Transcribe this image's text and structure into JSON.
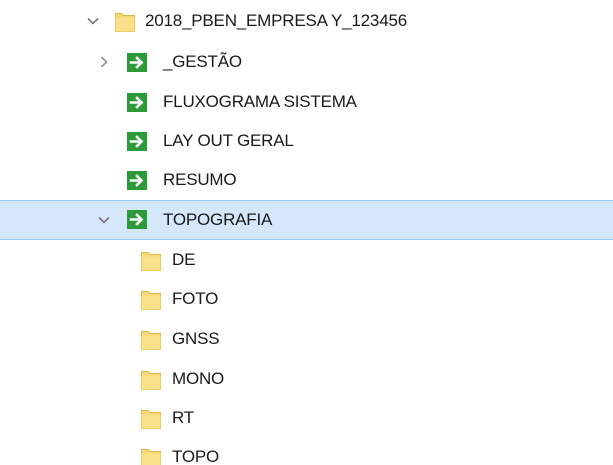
{
  "tree": {
    "root": {
      "label": "2018_PBEN_EMPRESA Y_123456",
      "expanded": true,
      "icon": "folder-icon"
    },
    "children": [
      {
        "label": "_GESTÃO",
        "icon": "shortcut-icon",
        "expandable": true,
        "expanded": false
      },
      {
        "label": "FLUXOGRAMA SISTEMA",
        "icon": "shortcut-icon"
      },
      {
        "label": "LAY OUT GERAL",
        "icon": "shortcut-icon"
      },
      {
        "label": "RESUMO",
        "icon": "shortcut-icon"
      },
      {
        "label": "TOPOGRAFIA",
        "icon": "shortcut-icon",
        "expandable": true,
        "expanded": true,
        "selected": true
      }
    ],
    "topografia_children": [
      {
        "label": "DE",
        "icon": "folder-icon"
      },
      {
        "label": "FOTO",
        "icon": "folder-icon"
      },
      {
        "label": "GNSS",
        "icon": "folder-icon"
      },
      {
        "label": "MONO",
        "icon": "folder-icon"
      },
      {
        "label": "RT",
        "icon": "folder-icon"
      },
      {
        "label": "TOPO",
        "icon": "folder-icon"
      }
    ]
  },
  "colors": {
    "folder": "#f8d775",
    "shortcut_bg": "#2b9b3a",
    "selection": "#d5e7fa",
    "selection_border": "#99c9f3"
  }
}
